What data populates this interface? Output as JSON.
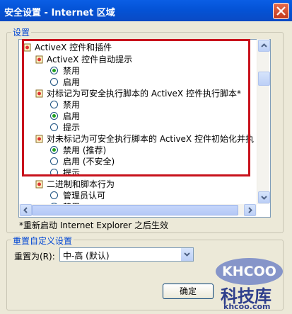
{
  "window": {
    "title": "安全设置 - Internet 区域"
  },
  "settings_group": {
    "label": "设置"
  },
  "tree": {
    "header": "ActiveX 控件和插件",
    "sections": [
      {
        "title": "ActiveX 控件自动提示",
        "options": [
          "禁用",
          "启用"
        ],
        "selected": 0
      },
      {
        "title": "对标记为可安全执行脚本的 ActiveX 控件执行脚本*",
        "options": [
          "禁用",
          "启用",
          "提示"
        ],
        "selected": 1
      },
      {
        "title": "对未标记为可安全执行脚本的 ActiveX 控件初始化并执",
        "options": [
          "禁用 (推荐)",
          "启用 (不安全)",
          "提示"
        ],
        "selected": 0
      },
      {
        "title": "二进制和脚本行为",
        "options": [
          "管理员认可",
          "禁用"
        ],
        "selected": -1
      }
    ]
  },
  "note": "*重新启动 Internet Explorer 之后生效",
  "reset_group": {
    "label": "重置自定义设置",
    "reset_to_label": "重置为(R):",
    "selected_value": "中-高 (默认)",
    "reset_button": "确定"
  },
  "watermark": {
    "logo": "KHCOO",
    "name": "科技库",
    "url": "khcoo.com"
  },
  "colors": {
    "title_bar": "#0453d6",
    "highlight": "#c8121c",
    "group_label": "#0046d5"
  }
}
